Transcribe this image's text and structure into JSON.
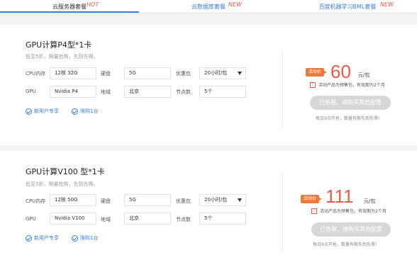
{
  "tabs": [
    {
      "label": "云服务器套餐",
      "badge": "HOT"
    },
    {
      "label": "云数据库套餐",
      "badge": "NEW"
    },
    {
      "label": "百度机器学习BML套餐",
      "badge": "NEW"
    }
  ],
  "cards": [
    {
      "title": "GPU计算P4型*1卡",
      "subtitle": "低至5折，限量抢购，先到先得。",
      "cpu_label": "CPU内存",
      "cpu_value": "12核 32G",
      "disk_label": "硬盘",
      "disk_value": "5G",
      "pkg_label": "优惠包",
      "pkg_value": "20小时/包",
      "gpu_label": "GPU",
      "gpu_value": "Nvidia P4",
      "region_label": "地域",
      "region_value": "北京",
      "nodes_label": "节点数",
      "nodes_value": "5个",
      "perk1": "新用户专享",
      "perk2": "限购1台",
      "tag": "活动价",
      "price": "60",
      "unit": "元/包",
      "note": "活动产品为预售包，有效期为2个月",
      "button": "已售罄，请购买其他配置",
      "footer": "每日9点开抢，数量有限先到先得！"
    },
    {
      "title": "GPU计算V100 型*1卡",
      "subtitle": "低至5折，限量抢购，先到先得。",
      "cpu_label": "CPU内存",
      "cpu_value": "12核 50G",
      "disk_label": "硬盘",
      "disk_value": "5G",
      "pkg_label": "优惠包",
      "pkg_value": "20小时/包",
      "gpu_label": "GPU",
      "gpu_value": "Nvidia V100",
      "region_label": "地域",
      "region_value": "北京",
      "nodes_label": "节点数",
      "nodes_value": "5个",
      "perk1": "新用户专享",
      "perk2": "限购1台",
      "tag": "活动价",
      "price": "111",
      "unit": "元/包",
      "note": "活动产品为预售包，有效期为2个月",
      "button": "已售罄，请购买其他配置",
      "footer": "每日9点开抢，数量有限先到先得！"
    }
  ]
}
